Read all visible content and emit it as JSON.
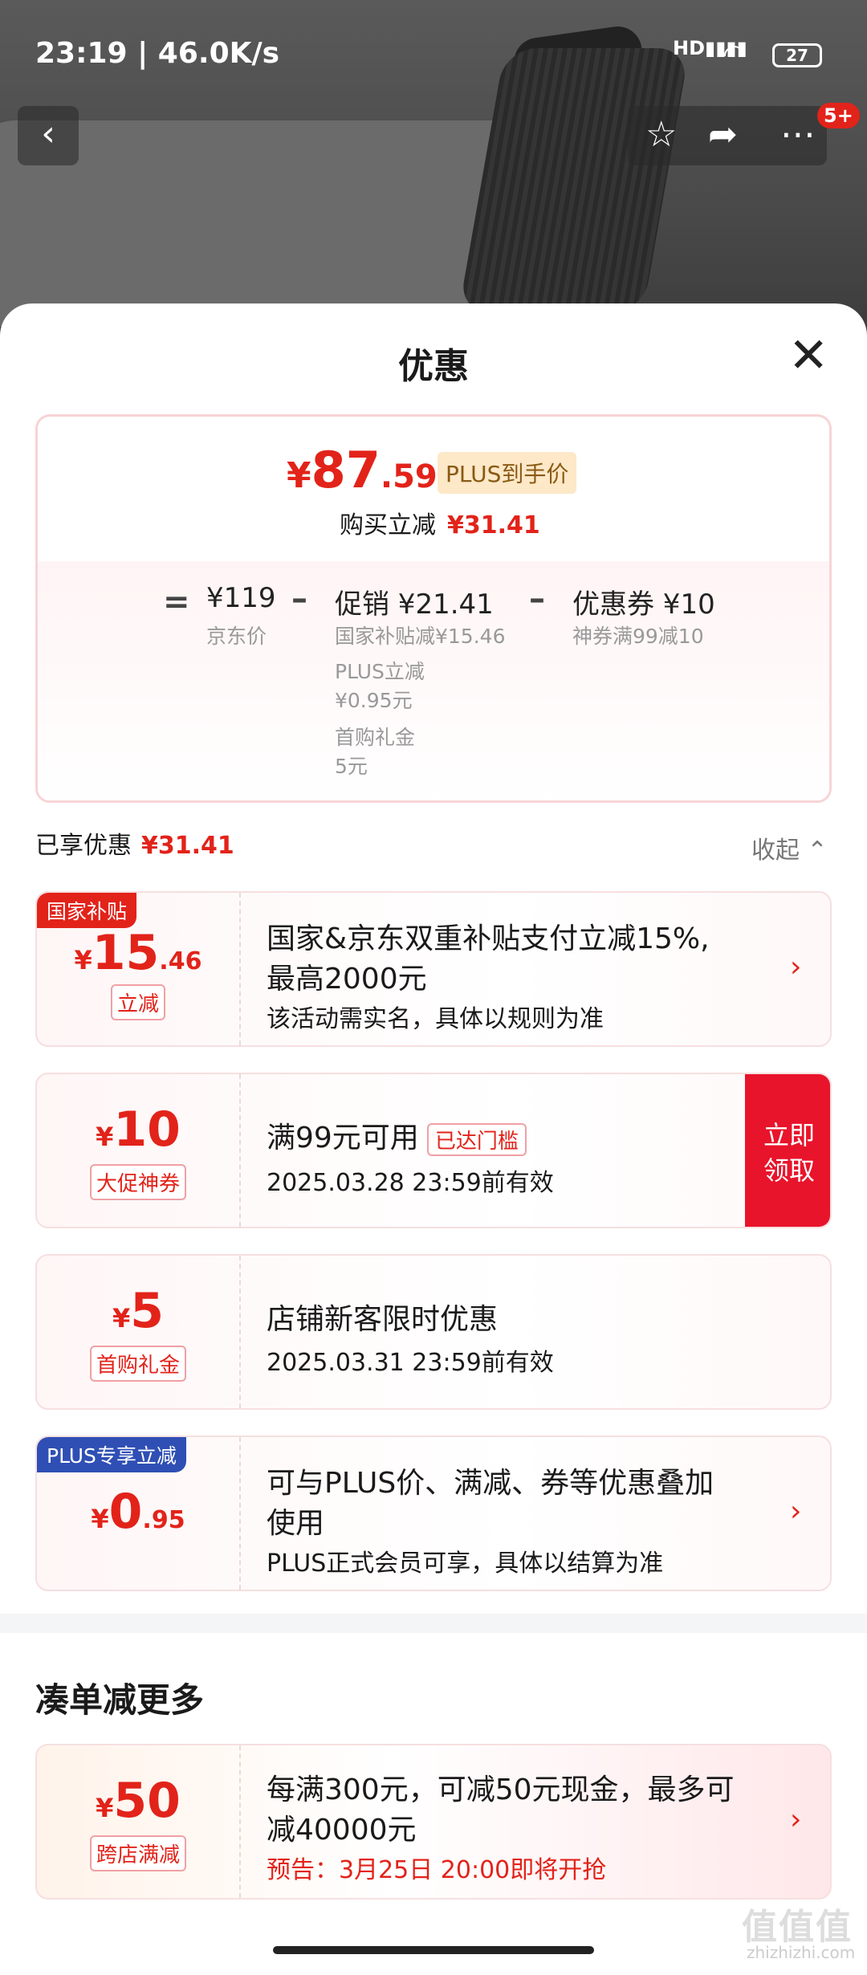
{
  "status": {
    "time": "23:19 | 46.0K/s",
    "signal": "HD",
    "battery": "27"
  },
  "nav": {
    "back_icon": "‹",
    "badge": "5+"
  },
  "sheet": {
    "title": "优惠",
    "price": {
      "currency": "¥",
      "integer": "87",
      "decimal": ".59",
      "tag": "PLUS到手价"
    },
    "buy_label": "购买立减",
    "buy_value": "¥31.41",
    "breakdown": {
      "eq": "=",
      "jd_price": "¥119",
      "jd_label": "京东价",
      "minus1": "–",
      "promo": "促销 ¥21.41",
      "promo_sub1": "国家补贴减¥15.46",
      "promo_sub2": "PLUS立减",
      "promo_sub2b": "¥0.95元",
      "promo_sub3": "首购礼金",
      "promo_sub3b": "5元",
      "minus2": "–",
      "coupon": "优惠券 ¥10",
      "coupon_sub": "神券满99减10"
    },
    "enjoyed_label": "已享优惠",
    "enjoyed_value": "¥31.41",
    "fold": "收起 ⌃"
  },
  "coupons": [
    {
      "tag": "国家补贴",
      "cur": "¥",
      "int": "15",
      "dec": ".46",
      "label": "立减",
      "line1": "国家&京东双重补贴支付立减15%,",
      "line2": "最高2000元",
      "line3": "该活动需实名，具体以规则为准",
      "arrow": "›"
    },
    {
      "cur": "¥",
      "int": "10",
      "dec": "",
      "label": "大促神券",
      "line1": "满99元可用",
      "reached": "已达门槛",
      "line3": "2025.03.28 23:59前有效",
      "claim1": "立即",
      "claim2": "领取"
    },
    {
      "cur": "¥",
      "int": "5",
      "dec": "",
      "label": "首购礼金",
      "line1": "店铺新客限时优惠",
      "line3": "2025.03.31 23:59前有效"
    },
    {
      "tag": "PLUS专享立减",
      "cur": "¥",
      "int": "0",
      "dec": ".95",
      "line1": "可与PLUS价、满减、券等优惠叠加",
      "line2": "使用",
      "line3": "PLUS正式会员可享，具体以结算为准",
      "arrow": "›"
    }
  ],
  "more": {
    "title": "凑单减更多",
    "card": {
      "cur": "¥",
      "int": "50",
      "label": "跨店满减",
      "line1": "每满300元，可减50元现金，最多可",
      "line2": "减40000元",
      "line3": "预告：3月25日 20:00即将开抢",
      "arrow": "›"
    }
  },
  "watermark": {
    "main": "值值值",
    "sub": "zhizhizhi.com"
  },
  "colors": {
    "accent": "#e2231a",
    "plus_tag_bg": "#fde8c8",
    "plus_blue": "#2f4fb4"
  }
}
